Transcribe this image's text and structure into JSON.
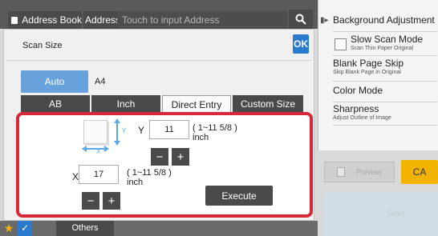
{
  "header": {
    "address_book_label": "Address Book",
    "address_label": "Address",
    "address_placeholder": "Touch to input Address",
    "search_icon": "search-icon"
  },
  "right_panel": {
    "items": [
      {
        "title": "Background Adjustment",
        "sub": ""
      },
      {
        "title": "Slow Scan Mode",
        "sub": "Scan Thin Paper Original"
      },
      {
        "title": "Blank Page Skip",
        "sub": "Skip Blank Page in Original"
      },
      {
        "title": "Color Mode",
        "sub": ""
      },
      {
        "title": "Sharpness",
        "sub": "Adjust Outline of Image"
      }
    ],
    "preview_label": "Preview",
    "ca_label": "CA",
    "start_label": "Start"
  },
  "dialog": {
    "title": "Scan Size",
    "ok_label": "OK",
    "auto_label": "Auto",
    "auto_value": "A4",
    "tabs": [
      "AB",
      "Inch",
      "Direct Entry",
      "Custom Size"
    ],
    "active_tab": "Direct Entry"
  },
  "entry": {
    "y_label": "Y",
    "y_value": "11",
    "y_range": "( 1~11 5/8 )",
    "y_unit": "inch",
    "x_label": "X",
    "x_value": "17",
    "x_range": "( 1~11 5/8 )",
    "x_unit": "inch",
    "minus": "−",
    "plus": "+",
    "execute_label": "Execute",
    "illus_y": "Y",
    "illus_x": "X"
  },
  "bottom": {
    "others_label": "Others"
  },
  "colors": {
    "accent_blue": "#2a7bd0",
    "auto_blue": "#67a2dc",
    "highlight_red": "#d8293b",
    "ca_yellow": "#f3b400"
  }
}
